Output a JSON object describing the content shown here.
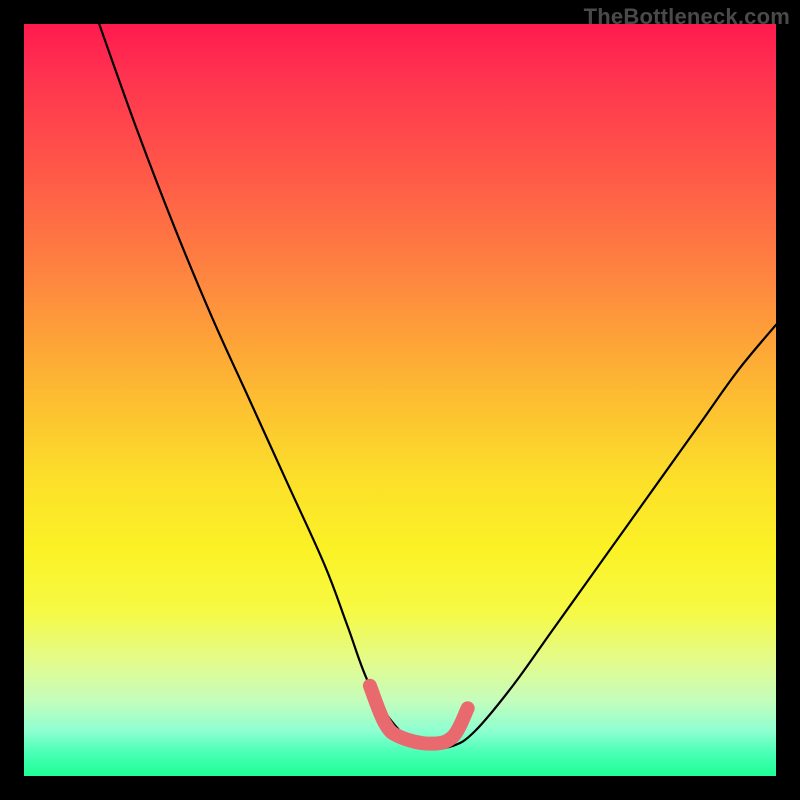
{
  "watermark": "TheBottleneck.com",
  "chart_data": {
    "type": "line",
    "title": "",
    "xlabel": "",
    "ylabel": "",
    "xlim": [
      0,
      100
    ],
    "ylim": [
      0,
      100
    ],
    "series": [
      {
        "name": "bottleneck-curve",
        "x": [
          10,
          15,
          20,
          25,
          30,
          35,
          40,
          43,
          46,
          50,
          54,
          57,
          60,
          65,
          70,
          75,
          80,
          85,
          90,
          95,
          100
        ],
        "y": [
          100,
          86,
          73,
          61,
          50,
          39,
          28,
          20,
          12,
          6,
          4,
          4,
          6,
          12,
          19,
          26,
          33,
          40,
          47,
          54,
          60
        ]
      },
      {
        "name": "optimal-zone-highlight",
        "x": [
          46,
          48,
          50,
          54,
          57,
          59
        ],
        "y": [
          12,
          7,
          5.2,
          4.3,
          5.2,
          9
        ]
      }
    ],
    "colors": {
      "curve": "#000000",
      "highlight": "#e96a6e",
      "gradient_top": "#ff1a4d",
      "gradient_bottom": "#1dff94"
    }
  }
}
